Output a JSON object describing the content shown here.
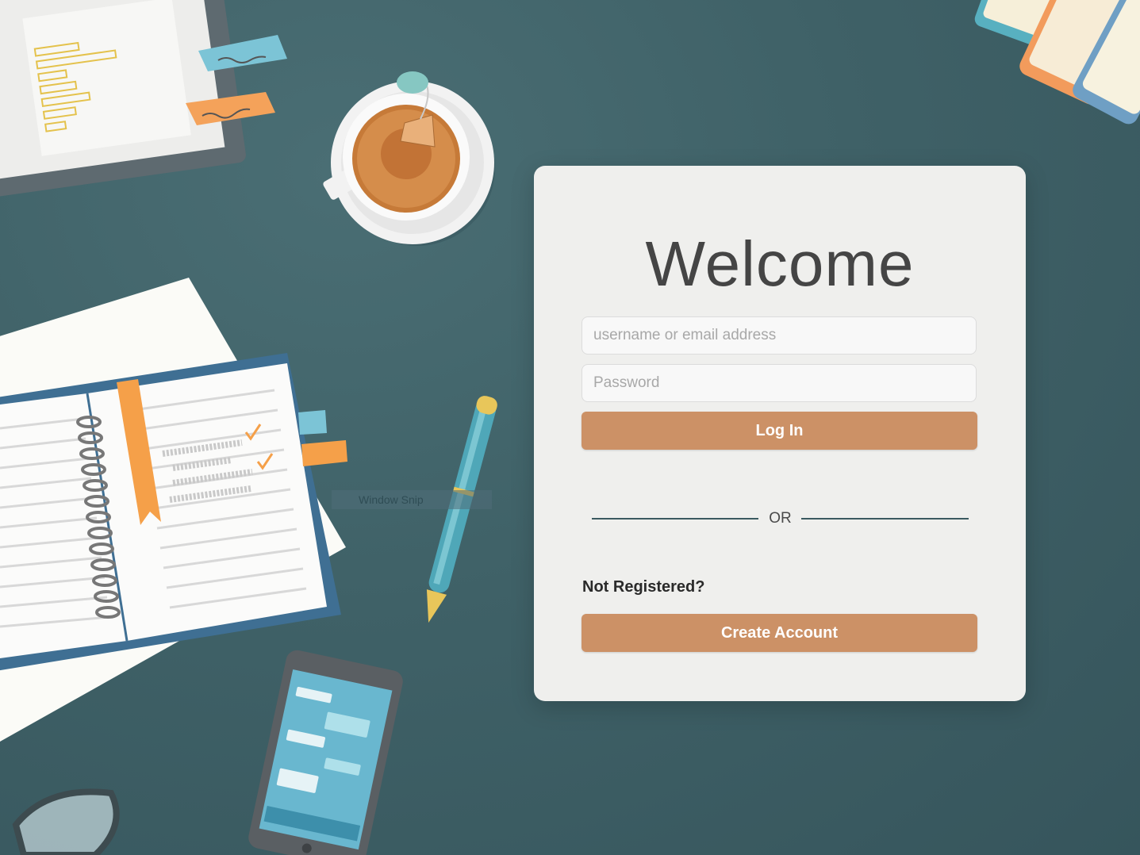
{
  "colors": {
    "background": "#3f6167",
    "card": "#efefed",
    "accent_button": "#cc9166",
    "button_text": "#ffffff",
    "divider": "#3b5a60"
  },
  "overlay": {
    "window_snip_label": "Window Snip"
  },
  "login": {
    "title": "Welcome",
    "username_placeholder": "username or email address",
    "password_placeholder": "Password",
    "login_button": "Log In",
    "divider_text": "OR",
    "not_registered": "Not Registered?",
    "create_account_button": "Create Account"
  },
  "icons": [
    "laptop-illustration",
    "tea-cup-illustration",
    "books-illustration",
    "notebook-illustration",
    "pen-illustration",
    "smartphone-illustration",
    "glasses-illustration"
  ]
}
